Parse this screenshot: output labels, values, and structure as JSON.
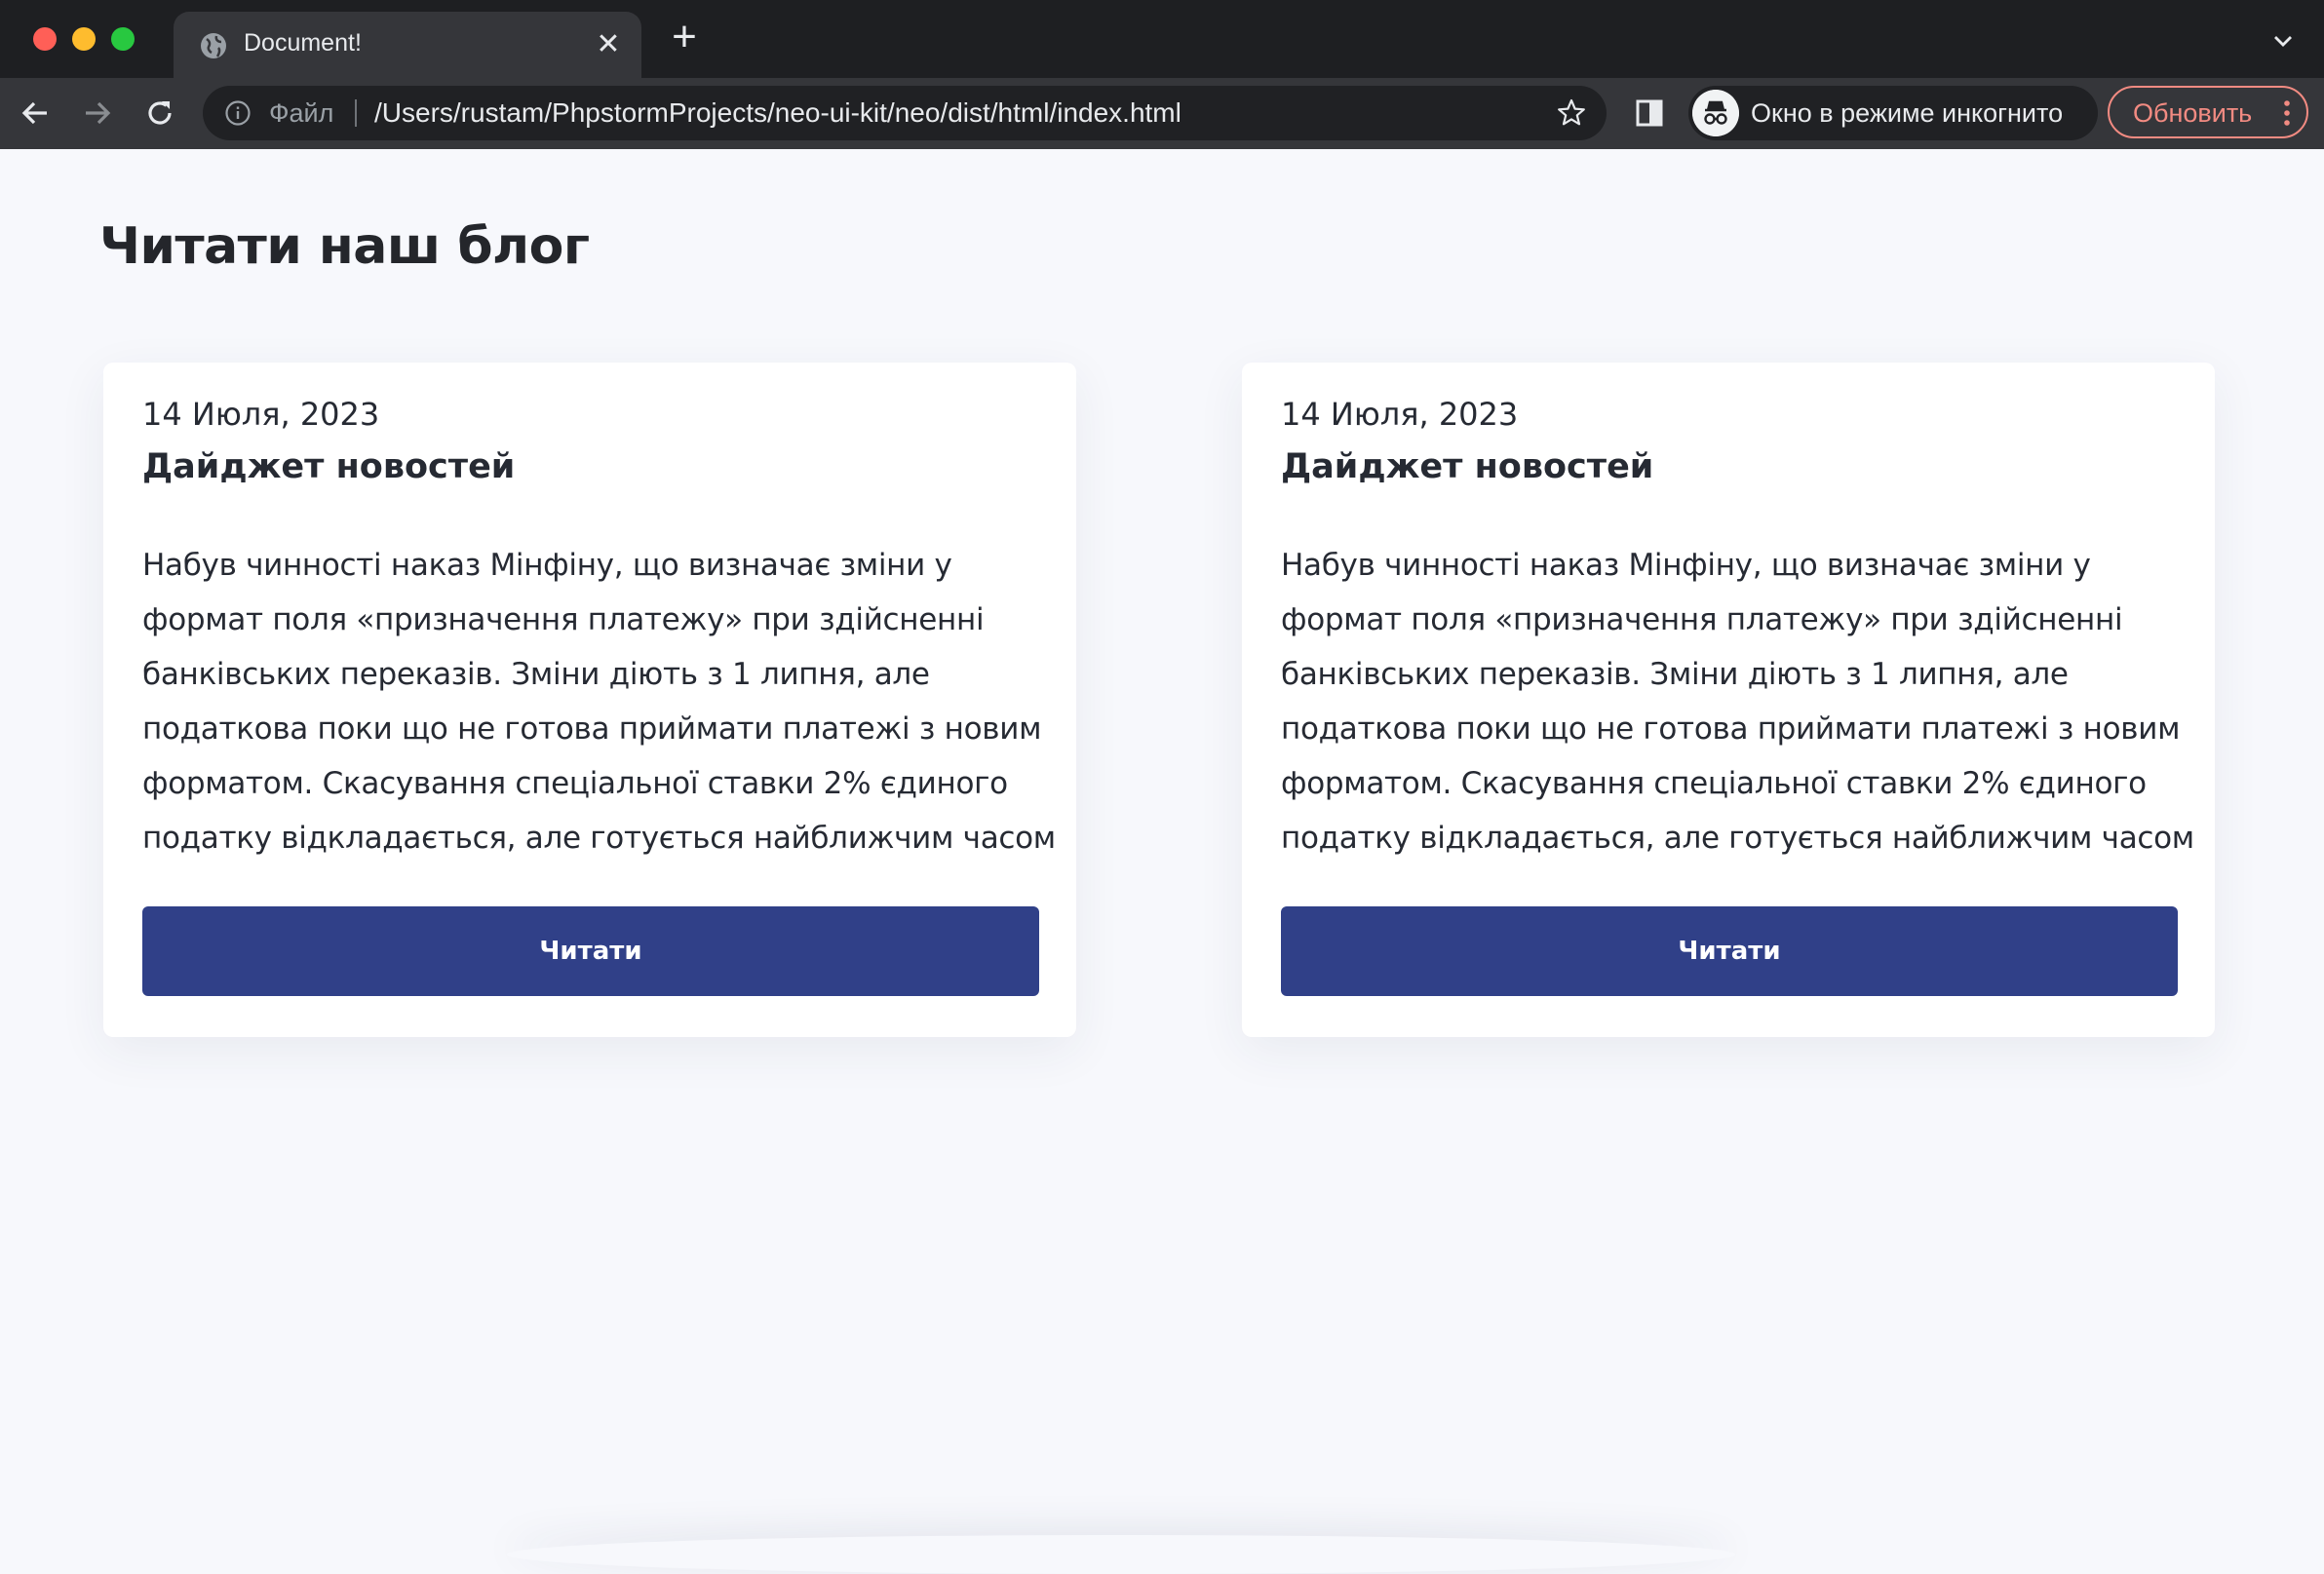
{
  "browser": {
    "tab_title": "Document!",
    "tab_icon": "globe-icon",
    "address": {
      "security_label": "Файл",
      "url": "/Users/rustam/PhpstormProjects/neo-ui-kit/neo/dist/html/index.html"
    },
    "incognito_label": "Окно в режиме инкогнито",
    "update_label": "Обновить",
    "colors": {
      "frame": "#1e1f22",
      "toolbar": "#35363a",
      "update_accent": "#f28b82"
    }
  },
  "page": {
    "heading": "Читати наш блог",
    "cards": [
      {
        "date": "14 Июля, 2023",
        "title": "Дайджет новостей",
        "text": "Набув чинності наказ Мінфіну, що визначає зміни у формат поля «призначення платежу» при здійсненні банківських переказів. Зміни діють з 1 липня, але податкова поки що не готова приймати платежі з новим форматом. Скасування спеціальної ставки 2% єдиного податку відкладається, але готується найближчим часом",
        "button": "Читати"
      },
      {
        "date": "14 Июля, 2023",
        "title": "Дайджет новостей",
        "text": "Набув чинності наказ Мінфіну, що визначає зміни у формат поля «призначення платежу» при здійсненні банківських переказів. Зміни діють з 1 липня, але податкова поки що не готова приймати платежі з новим форматом. Скасування спеціальної ставки 2% єдиного податку відкладається, але готується найближчим часом",
        "button": "Читати"
      }
    ],
    "colors": {
      "background": "#f7f8fc",
      "button": "#304088",
      "text": "#262a33"
    }
  }
}
